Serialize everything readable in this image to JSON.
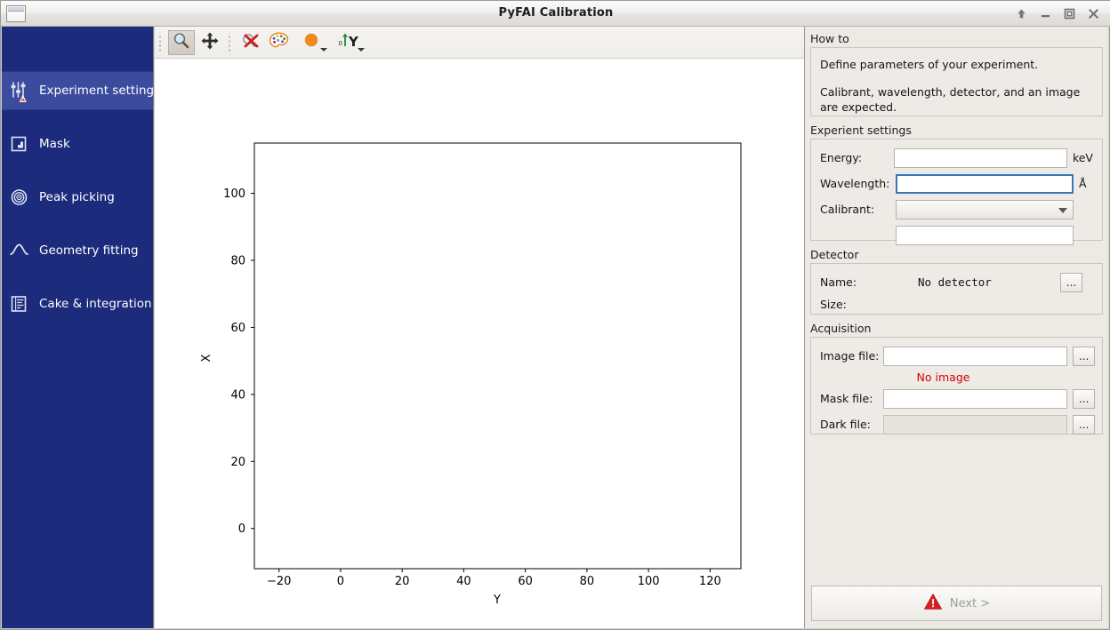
{
  "window": {
    "title": "PyFAI Calibration",
    "icon": "window-icon",
    "controls": [
      {
        "name": "shade-button",
        "glyph": "up-arrow"
      },
      {
        "name": "minimize-button",
        "glyph": "minimize"
      },
      {
        "name": "maximize-button",
        "glyph": "maximize"
      },
      {
        "name": "close-button",
        "glyph": "close"
      }
    ]
  },
  "sidebar": {
    "items": [
      {
        "label": "Experiment settings",
        "icon": "sliders-icon",
        "badge": "warning-badge",
        "selected": true
      },
      {
        "label": "Mask",
        "icon": "mask-icon",
        "selected": false
      },
      {
        "label": "Peak picking",
        "icon": "target-icon",
        "selected": false
      },
      {
        "label": "Geometry fitting",
        "icon": "peak-curve-icon",
        "selected": false
      },
      {
        "label": "Cake & integration",
        "icon": "document-bars-icon",
        "selected": false
      }
    ]
  },
  "toolbar": {
    "buttons": [
      {
        "name": "zoom-tool-button",
        "icon": "magnifier-icon",
        "pressed": true
      },
      {
        "name": "pan-tool-button",
        "icon": "move-arrows-icon",
        "pressed": false
      },
      {
        "name": "reset-zoom-button",
        "icon": "zoom-reset-x-icon",
        "pressed": false
      },
      {
        "name": "colormap-button",
        "icon": "palette-icon",
        "pressed": false
      },
      {
        "name": "marker-color-button",
        "icon": "orange-circle-icon",
        "pressed": false,
        "has_menu": true
      },
      {
        "name": "y-axis-direction-button",
        "icon": "y-axis-arrow-icon",
        "pressed": false,
        "has_menu": true
      }
    ]
  },
  "chart_data": {
    "type": "scatter",
    "title": "",
    "xlabel": "Y",
    "ylabel": "X",
    "x": [],
    "y": [],
    "series": [],
    "xticks": [
      -20,
      0,
      20,
      40,
      60,
      80,
      100,
      120
    ],
    "xticklabels": [
      "−20",
      "0",
      "20",
      "40",
      "60",
      "80",
      "100",
      "120"
    ],
    "yticks": [
      0,
      20,
      40,
      60,
      80,
      100
    ],
    "yticklabels": [
      "0",
      "20",
      "40",
      "60",
      "80",
      "100"
    ],
    "xlim": [
      -28,
      130
    ],
    "ylim": [
      -12,
      115
    ],
    "grid": false,
    "legend": null,
    "plot_bg": "#ffffff",
    "frame_color": "#000000"
  },
  "right_panel": {
    "howto": {
      "section_title": "How to",
      "line1": "Define parameters of your experiment.",
      "line2": "Calibrant, wavelength, detector, and an image",
      "line3": "are expected."
    },
    "experiment": {
      "section_title": "Experient settings",
      "energy_label": "Energy:",
      "energy_value": "",
      "energy_unit": "keV",
      "wavelength_label": "Wavelength:",
      "wavelength_value": "",
      "wavelength_unit": "Å",
      "calibrant_label": "Calibrant:",
      "calibrant_value": "",
      "calibrant_extra_value": ""
    },
    "detector": {
      "section_title": "Detector",
      "name_label": "Name:",
      "name_value": "No detector",
      "size_label": "Size:",
      "size_value": "",
      "browse_label": "..."
    },
    "acquisition": {
      "section_title": "Acquisition",
      "image_label": "Image file:",
      "image_value": "",
      "image_status": "No image",
      "mask_label": "Mask file:",
      "mask_value": "",
      "dark_label": "Dark file:",
      "dark_value": "",
      "browse_label": "..."
    },
    "next_button": {
      "label": "Next >",
      "icon": "warning-triangle-icon",
      "enabled": false
    }
  },
  "colors": {
    "sidebar_bg": "#1c2b7b",
    "sidebar_selected": "#3b4b9e",
    "panel_bg": "#edeae5",
    "error_text": "#d40000",
    "focus_border": "#3a78b8",
    "warning_red": "#d91f1f",
    "marker_orange": "#f08a1e"
  }
}
